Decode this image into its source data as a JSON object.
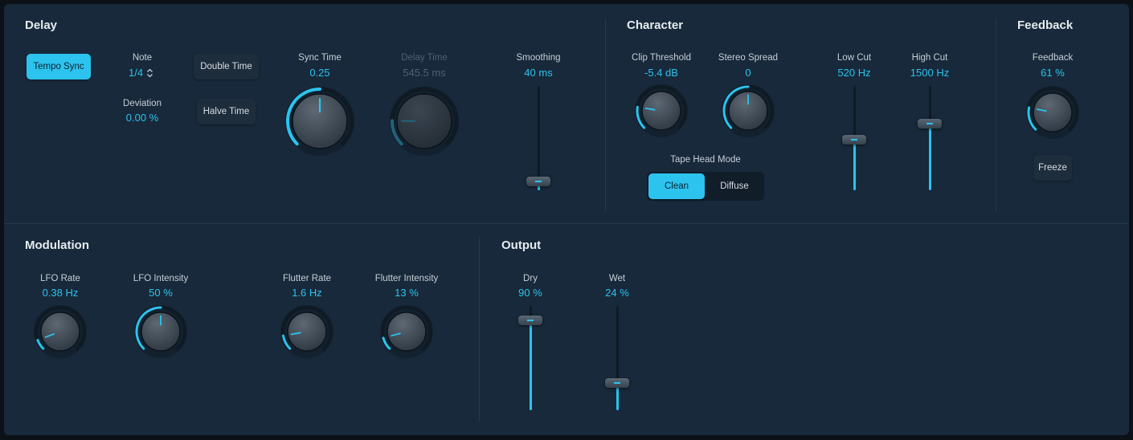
{
  "colors": {
    "accent": "#2cc3ee",
    "panel": "#17293a",
    "track": "#0f1a24"
  },
  "delay": {
    "title": "Delay",
    "tempo_sync_label": "Tempo Sync",
    "note_label": "Note",
    "note_value": "1/4",
    "deviation_label": "Deviation",
    "deviation_value": "0.00 %",
    "double_time_label": "Double Time",
    "halve_time_label": "Halve Time",
    "sync_time_label": "Sync Time",
    "sync_time_value": "0.25",
    "delay_time_label": "Delay Time",
    "delay_time_value": "545.5 ms",
    "smoothing_label": "Smoothing",
    "smoothing_value": "40 ms"
  },
  "character": {
    "title": "Character",
    "clip_threshold_label": "Clip Threshold",
    "clip_threshold_value": "-5.4 dB",
    "stereo_spread_label": "Stereo Spread",
    "stereo_spread_value": "0",
    "low_cut_label": "Low Cut",
    "low_cut_value": "520 Hz",
    "high_cut_label": "High Cut",
    "high_cut_value": "1500 Hz",
    "tape_head_mode_label": "Tape Head Mode",
    "clean_label": "Clean",
    "diffuse_label": "Diffuse"
  },
  "feedback": {
    "title": "Feedback",
    "feedback_label": "Feedback",
    "feedback_value": "61 %",
    "freeze_label": "Freeze"
  },
  "modulation": {
    "title": "Modulation",
    "lfo_rate_label": "LFO Rate",
    "lfo_rate_value": "0.38 Hz",
    "lfo_intensity_label": "LFO Intensity",
    "lfo_intensity_value": "50 %",
    "flutter_rate_label": "Flutter Rate",
    "flutter_rate_value": "1.6 Hz",
    "flutter_intensity_label": "Flutter Intensity",
    "flutter_intensity_value": "13 %"
  },
  "output": {
    "title": "Output",
    "dry_label": "Dry",
    "dry_value": "90 %",
    "wet_label": "Wet",
    "wet_value": "24 %"
  },
  "knob_levels": {
    "sync_time": 0.5,
    "delay_time": 0.17,
    "clip_threshold": 0.2,
    "stereo_spread": 0.5,
    "feedback": 0.21,
    "lfo_rate": 0.09,
    "lfo_intensity": 0.5,
    "flutter_rate": 0.13,
    "flutter_intensity": 0.11
  },
  "slider_levels": {
    "smoothing": 0.04,
    "low_cut": 0.48,
    "high_cut": 0.65,
    "dry": 0.9,
    "wet": 0.24
  }
}
